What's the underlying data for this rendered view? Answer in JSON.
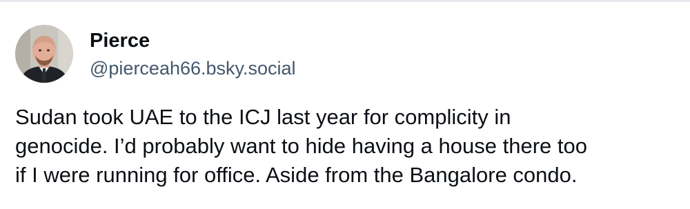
{
  "post": {
    "author": {
      "display_name": "Pierce",
      "handle": "@pierceah66.bsky.social",
      "avatar_icon": "user-avatar-photo"
    },
    "text_lines": [
      "Sudan took UAE to the ICJ last year for complicity in",
      "genocide. I’d probably want to hide having a house there too",
      "if I were running for office. Aside from the Bangalore condo."
    ]
  },
  "colors": {
    "name": "#0b0f14",
    "handle": "#42576c",
    "text": "#0b0f14",
    "border": "#e6e9ed"
  }
}
